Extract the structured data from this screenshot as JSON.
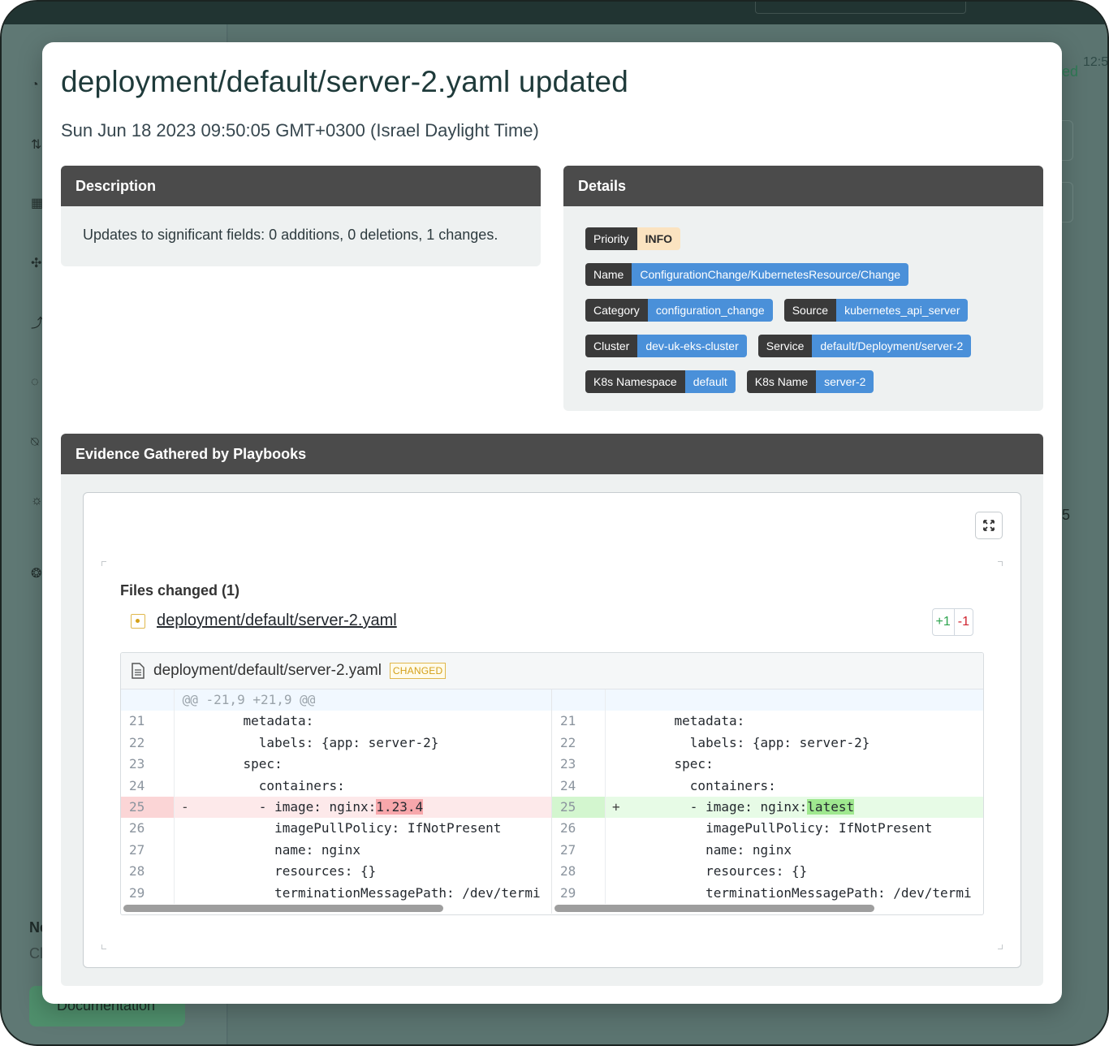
{
  "background": {
    "right_fragments": [
      "ed",
      "12:5",
      "5"
    ],
    "sidebar_bottom": {
      "heading_fragment": "Ne",
      "sub_fragment": "Cl",
      "doc_button": "Documentation"
    }
  },
  "modal": {
    "title": "deployment/default/server-2.yaml updated",
    "timestamp": "Sun Jun 18 2023 09:50:05 GMT+0300 (Israel Daylight Time)",
    "description": {
      "header": "Description",
      "text": "Updates to significant fields: 0 additions, 0 deletions, 1 changes."
    },
    "details": {
      "header": "Details",
      "rows": [
        [
          {
            "key": "Priority",
            "value": "INFO"
          }
        ],
        [
          {
            "key": "Name",
            "value": "ConfigurationChange/KubernetesResource/Change"
          }
        ],
        [
          {
            "key": "Category",
            "value": "configuration_change"
          },
          {
            "key": "Source",
            "value": "kubernetes_api_server"
          }
        ],
        [
          {
            "key": "Cluster",
            "value": "dev-uk-eks-cluster"
          },
          {
            "key": "Service",
            "value": "default/Deployment/server-2"
          }
        ],
        [
          {
            "key": "K8s Namespace",
            "value": "default"
          },
          {
            "key": "K8s Name",
            "value": "server-2"
          }
        ]
      ]
    },
    "evidence": {
      "header": "Evidence Gathered by Playbooks",
      "files_changed_label": "Files changed (1)",
      "file_name": "deployment/default/server-2.yaml",
      "additions": "+1",
      "deletions": "-1",
      "diff": {
        "file_name": "deployment/default/server-2.yaml",
        "badge": "CHANGED",
        "hunk": "@@ -21,9 +21,9 @@",
        "left": [
          {
            "n": "21",
            "code": "    metadata:"
          },
          {
            "n": "22",
            "code": "      labels: {app: server-2}"
          },
          {
            "n": "23",
            "code": "    spec:"
          },
          {
            "n": "24",
            "code": "      containers:"
          },
          {
            "n": "25",
            "mark": "-",
            "prefix": "      - image: nginx:",
            "hl": "1.23.4",
            "type": "del"
          },
          {
            "n": "26",
            "code": "        imagePullPolicy: IfNotPresent"
          },
          {
            "n": "27",
            "code": "        name: nginx"
          },
          {
            "n": "28",
            "code": "        resources: {}"
          },
          {
            "n": "29",
            "code": "        terminationMessagePath: /dev/termi"
          }
        ],
        "right": [
          {
            "n": "21",
            "code": "    metadata:"
          },
          {
            "n": "22",
            "code": "      labels: {app: server-2}"
          },
          {
            "n": "23",
            "code": "    spec:"
          },
          {
            "n": "24",
            "code": "      containers:"
          },
          {
            "n": "25",
            "mark": "+",
            "prefix": "      - image: nginx:",
            "hl": "latest",
            "type": "add"
          },
          {
            "n": "26",
            "code": "        imagePullPolicy: IfNotPresent"
          },
          {
            "n": "27",
            "code": "        name: nginx"
          },
          {
            "n": "28",
            "code": "        resources: {}"
          },
          {
            "n": "29",
            "code": "        terminationMessagePath: /dev/termi"
          }
        ]
      }
    }
  }
}
